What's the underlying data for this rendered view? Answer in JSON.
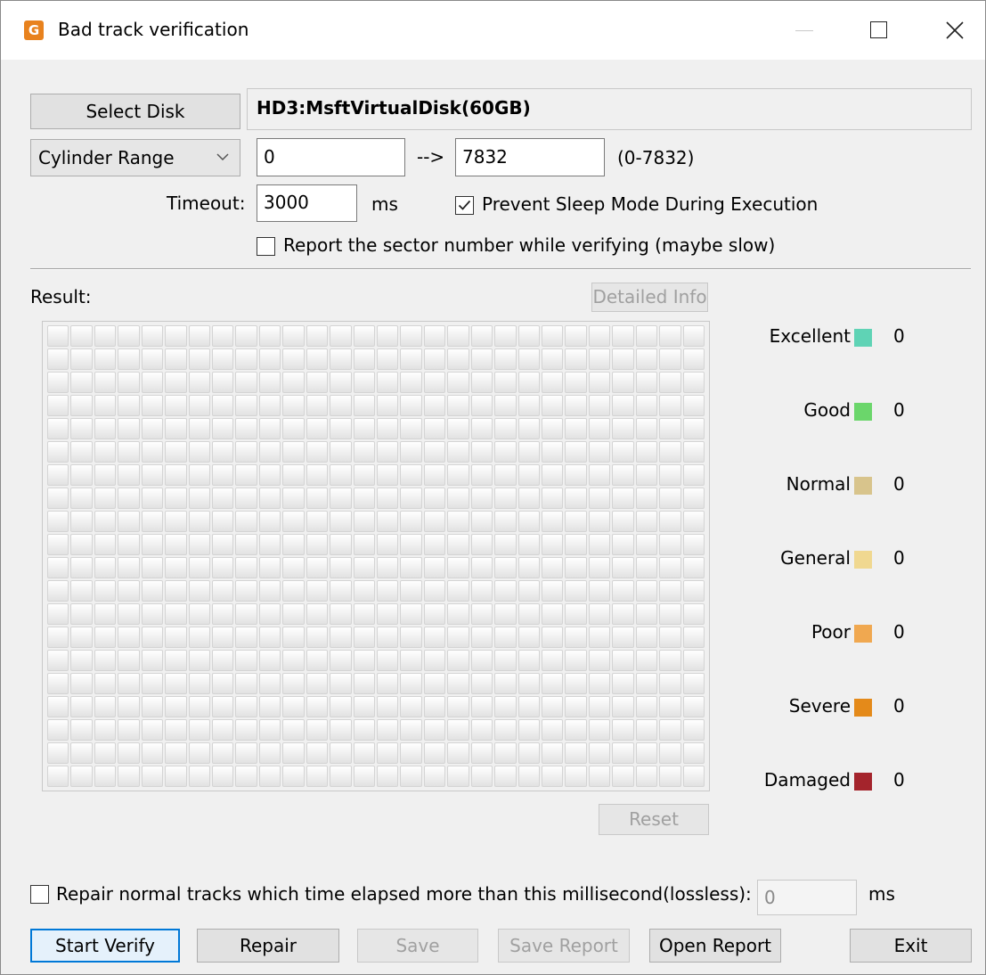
{
  "window": {
    "title": "Bad track verification",
    "app_icon_letter": "G"
  },
  "disk": {
    "select_label": "Select Disk",
    "name": "HD3:MsftVirtualDisk(60GB)"
  },
  "range": {
    "mode": "Cylinder Range",
    "start": "0",
    "arrow": "-->",
    "end": "7832",
    "limits": "(0-7832)"
  },
  "timeout": {
    "label": "Timeout:",
    "value": "3000",
    "unit": "ms"
  },
  "options": {
    "prevent_sleep": {
      "label": "Prevent Sleep Mode During Execution",
      "checked": true
    },
    "report_sector": {
      "label": "Report the sector number while verifying (maybe slow)",
      "checked": false
    }
  },
  "result": {
    "label": "Result:",
    "detailed_info": "Detailed Info",
    "reset": "Reset",
    "grid": {
      "columns": 28,
      "rows": 20
    }
  },
  "legend": [
    {
      "label": "Excellent",
      "count": "0",
      "color": "#5fd3b5"
    },
    {
      "label": "Good",
      "count": "0",
      "color": "#6bd66b"
    },
    {
      "label": "Normal",
      "count": "0",
      "color": "#d8c48c"
    },
    {
      "label": "General",
      "count": "0",
      "color": "#f0d890"
    },
    {
      "label": "Poor",
      "count": "0",
      "color": "#f0a850"
    },
    {
      "label": "Severe",
      "count": "0",
      "color": "#e48a1a"
    },
    {
      "label": "Damaged",
      "count": "0",
      "color": "#a4242c"
    }
  ],
  "repair_option": {
    "label": "Repair normal tracks which time elapsed more than this millisecond(lossless):",
    "checked": false,
    "value": "0",
    "unit": "ms"
  },
  "buttons": {
    "start_verify": "Start Verify",
    "repair": "Repair",
    "save": "Save",
    "save_report": "Save Report",
    "open_report": "Open Report",
    "exit": "Exit"
  }
}
